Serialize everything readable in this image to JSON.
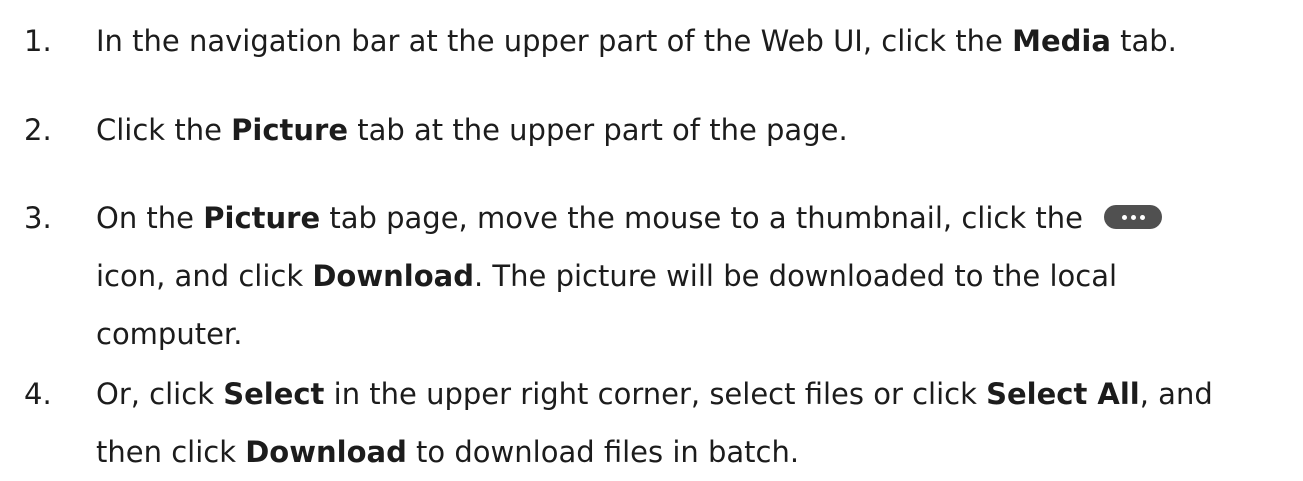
{
  "steps": [
    {
      "number": "1.",
      "lines": [
        [
          {
            "text": "In the navigation bar at the upper part of the Web UI, click the  "
          },
          {
            "text": "Media",
            "bold": true
          },
          {
            "text": " tab."
          }
        ]
      ]
    },
    {
      "number": "2.",
      "lines": [
        [
          {
            "text": "Click the "
          },
          {
            "text": "Picture",
            "bold": true
          },
          {
            "text": " tab at the upper part of the page."
          }
        ]
      ]
    },
    {
      "number": "3.",
      "lines": [
        [
          {
            "text": "On the "
          },
          {
            "text": "Picture",
            "bold": true
          },
          {
            "text": " tab page, move the mouse to a thumbnail, click the "
          },
          {
            "icon": "more-icon"
          }
        ],
        [
          {
            "text": "icon, and click "
          },
          {
            "text": "Download",
            "bold": true
          },
          {
            "text": ". The picture will be downloaded to the local"
          }
        ],
        [
          {
            "text": "computer."
          }
        ]
      ]
    },
    {
      "number": "4.",
      "lines": [
        [
          {
            "text": "Or, click "
          },
          {
            "text": "Select",
            "bold": true
          },
          {
            "text": " in the upper right corner, select files or click  "
          },
          {
            "text": "Select All",
            "bold": true
          },
          {
            "text": ", and"
          }
        ],
        [
          {
            "text": "then click "
          },
          {
            "text": "Download",
            "bold": true
          },
          {
            "text": " to download files in batch."
          }
        ]
      ]
    }
  ]
}
